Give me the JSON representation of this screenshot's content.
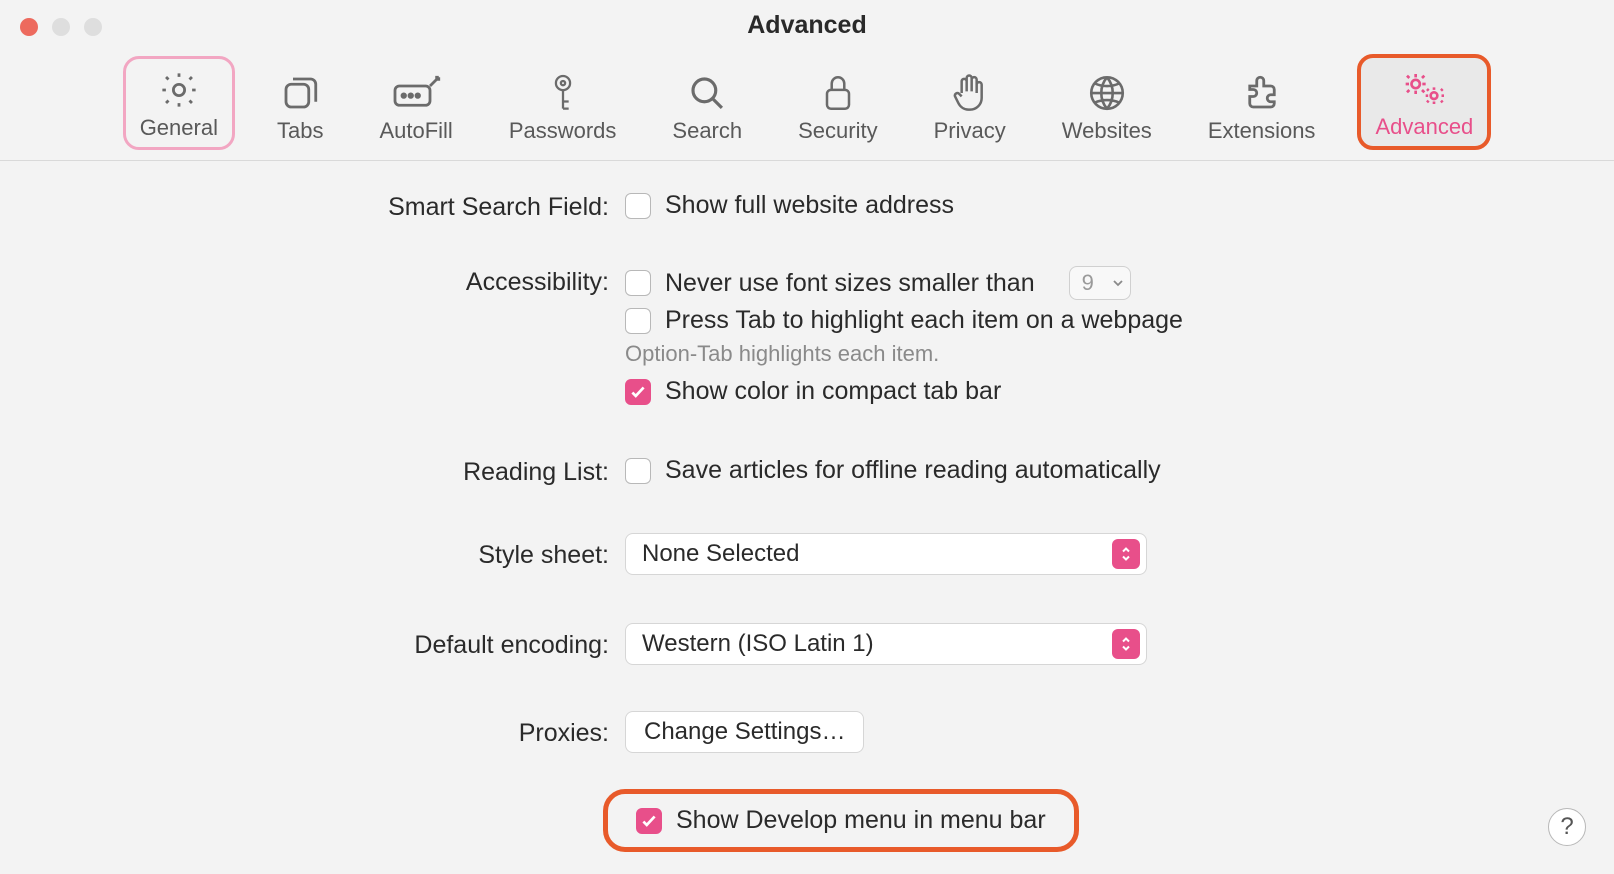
{
  "window": {
    "title": "Advanced"
  },
  "toolbar": {
    "items": [
      {
        "label": "General"
      },
      {
        "label": "Tabs"
      },
      {
        "label": "AutoFill"
      },
      {
        "label": "Passwords"
      },
      {
        "label": "Search"
      },
      {
        "label": "Security"
      },
      {
        "label": "Privacy"
      },
      {
        "label": "Websites"
      },
      {
        "label": "Extensions"
      },
      {
        "label": "Advanced"
      }
    ]
  },
  "sections": {
    "smartSearch": {
      "label": "Smart Search Field:",
      "showFullAddress": {
        "label": "Show full website address",
        "checked": false
      }
    },
    "accessibility": {
      "label": "Accessibility:",
      "neverSmaller": {
        "label": "Never use font sizes smaller than",
        "checked": false,
        "value": "9"
      },
      "pressTab": {
        "label": "Press Tab to highlight each item on a webpage",
        "checked": false
      },
      "pressTabHint": "Option-Tab highlights each item.",
      "showColor": {
        "label": "Show color in compact tab bar",
        "checked": true
      }
    },
    "readingList": {
      "label": "Reading List:",
      "saveOffline": {
        "label": "Save articles for offline reading automatically",
        "checked": false
      }
    },
    "styleSheet": {
      "label": "Style sheet:",
      "value": "None Selected"
    },
    "defaultEncoding": {
      "label": "Default encoding:",
      "value": "Western (ISO Latin 1)"
    },
    "proxies": {
      "label": "Proxies:",
      "button": "Change Settings…"
    },
    "develop": {
      "label": "Show Develop menu in menu bar",
      "checked": true
    }
  },
  "help": "?"
}
